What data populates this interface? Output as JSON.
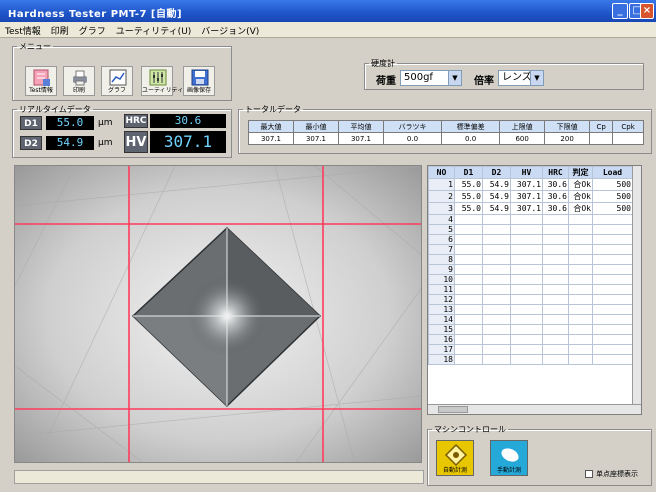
{
  "window": {
    "title": "Hardness Tester PMT-7 [自動]",
    "buttons": [
      "_",
      "□",
      "×"
    ]
  },
  "menu": [
    "Test情報",
    "印刷",
    "グラフ",
    "ユーティリティ(U)",
    "バージョン(V)"
  ],
  "toolbar": {
    "legend": "メニュー",
    "buttons": [
      {
        "label": "Test情報",
        "icon": "test-info-icon"
      },
      {
        "label": "印刷",
        "icon": "printer-icon"
      },
      {
        "label": "グラフ",
        "icon": "graph-icon"
      },
      {
        "label": "ユーティリティ",
        "icon": "utility-icon"
      },
      {
        "label": "画像保存",
        "icon": "image-save-icon"
      }
    ]
  },
  "hardness_meter": {
    "legend": "硬度計",
    "load_label": "荷重",
    "load_value": "500gf",
    "magnification_label": "倍率",
    "magnification_value": "レンズ'A"
  },
  "realtime": {
    "legend": "リアルタイムデータ",
    "d1_label": "D1",
    "d1_value": "55.0",
    "d1_unit": "μm",
    "d2_label": "D2",
    "d2_value": "54.9",
    "d2_unit": "μm",
    "hrc_label": "HRC",
    "hrc_value": "30.6",
    "hv_label": "HV",
    "hv_value": "307.1"
  },
  "totals": {
    "legend": "トータルデータ",
    "headers": [
      "最大値",
      "最小値",
      "平均値",
      "バラツキ",
      "標準偏差",
      "上限値",
      "下限値",
      "Cp",
      "Cpk"
    ],
    "values": [
      "307.1",
      "307.1",
      "307.1",
      "0.0",
      "0.0",
      "600",
      "200",
      "",
      ""
    ]
  },
  "grid": {
    "headers": [
      "NO",
      "D1",
      "D2",
      "HV",
      "HRC",
      "判定",
      "Load"
    ],
    "rows": [
      [
        "1",
        "55.0",
        "54.9",
        "307.1",
        "30.6",
        "合Ok",
        "500"
      ],
      [
        "2",
        "55.0",
        "54.9",
        "307.1",
        "30.6",
        "合Ok",
        "500"
      ],
      [
        "3",
        "55.0",
        "54.9",
        "307.1",
        "30.6",
        "合Ok",
        "500"
      ],
      [
        "4",
        "",
        "",
        "",
        "",
        "",
        ""
      ],
      [
        "5",
        "",
        "",
        "",
        "",
        "",
        ""
      ],
      [
        "6",
        "",
        "",
        "",
        "",
        "",
        ""
      ],
      [
        "7",
        "",
        "",
        "",
        "",
        "",
        ""
      ],
      [
        "8",
        "",
        "",
        "",
        "",
        "",
        ""
      ],
      [
        "9",
        "",
        "",
        "",
        "",
        "",
        ""
      ],
      [
        "10",
        "",
        "",
        "",
        "",
        "",
        ""
      ],
      [
        "11",
        "",
        "",
        "",
        "",
        "",
        ""
      ],
      [
        "12",
        "",
        "",
        "",
        "",
        "",
        ""
      ],
      [
        "13",
        "",
        "",
        "",
        "",
        "",
        ""
      ],
      [
        "14",
        "",
        "",
        "",
        "",
        "",
        ""
      ],
      [
        "15",
        "",
        "",
        "",
        "",
        "",
        ""
      ],
      [
        "16",
        "",
        "",
        "",
        "",
        "",
        ""
      ],
      [
        "17",
        "",
        "",
        "",
        "",
        "",
        ""
      ],
      [
        "18",
        "",
        "",
        "",
        "",
        "",
        ""
      ]
    ]
  },
  "machine_control": {
    "legend": "マシンコントロール",
    "auto_measure_label": "自動計測",
    "manual_measure_label": "手動計測",
    "coord_checkbox_label": "单点座標表示"
  },
  "colors": {
    "accent_blue": "#1f55c9",
    "display_text": "#6fd3ff",
    "crosshair": "#ff3b5c"
  }
}
